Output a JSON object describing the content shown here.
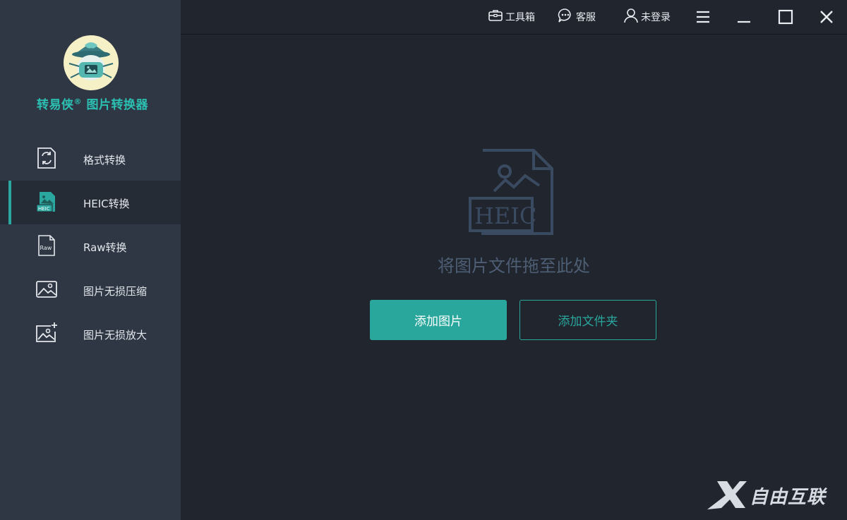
{
  "app": {
    "title": "转易侠",
    "title_mark": "®",
    "title_suffix": "图片转换器"
  },
  "topbar": {
    "toolbox": "工具箱",
    "service": "客服",
    "login": "未登录"
  },
  "sidebar": {
    "items": [
      {
        "label": "格式转换",
        "icon": "format-convert-icon"
      },
      {
        "label": "HEIC转换",
        "icon": "heic-icon",
        "active": true
      },
      {
        "label": "Raw转换",
        "icon": "raw-icon"
      },
      {
        "label": "图片无损压缩",
        "icon": "image-compress-icon"
      },
      {
        "label": "图片无损放大",
        "icon": "image-enlarge-icon"
      }
    ]
  },
  "main": {
    "drop_hint": "将图片文件拖至此处",
    "icon_label": "HEIC",
    "add_images": "添加图片",
    "add_folder": "添加文件夹"
  },
  "watermark": {
    "text": "自由互联"
  },
  "colors": {
    "accent": "#29a79d",
    "sidebar_bg": "#2f3744",
    "main_bg": "#21252e",
    "title_color": "#2bc0b2"
  }
}
